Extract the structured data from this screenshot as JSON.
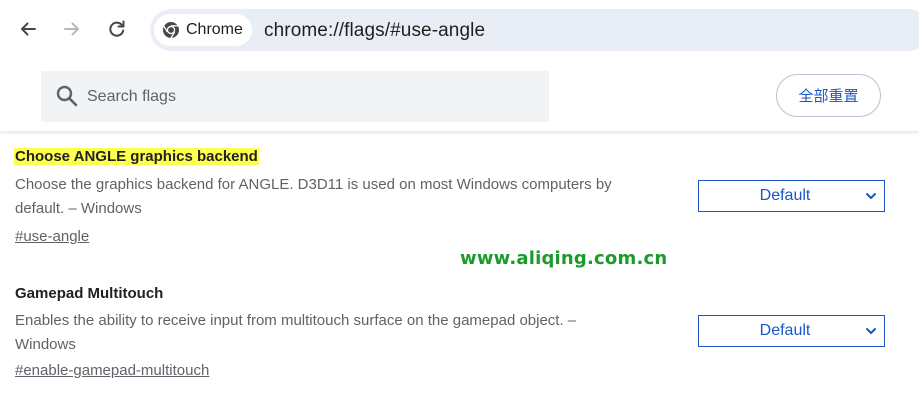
{
  "browser": {
    "chip_label": "Chrome",
    "url": "chrome://flags/#use-angle"
  },
  "header": {
    "search_placeholder": "Search flags",
    "reset_label": "全部重置"
  },
  "experiments": [
    {
      "title": "Choose ANGLE graphics backend",
      "description": "Choose the graphics backend for ANGLE. D3D11 is used on most Windows computers by default. – Windows",
      "link": "#use-angle",
      "selected": "Default",
      "highlighted": true
    },
    {
      "title": "Gamepad Multitouch",
      "description": "Enables the ability to receive input from multitouch surface on the gamepad object. – Windows",
      "link": "#enable-gamepad-multitouch",
      "selected": "Default",
      "highlighted": false
    }
  ],
  "watermark": "www.aliqing.com.cn",
  "colors": {
    "accent": "#1a56c4",
    "highlight": "#ffff4d",
    "watermark": "#1c9a2b"
  }
}
